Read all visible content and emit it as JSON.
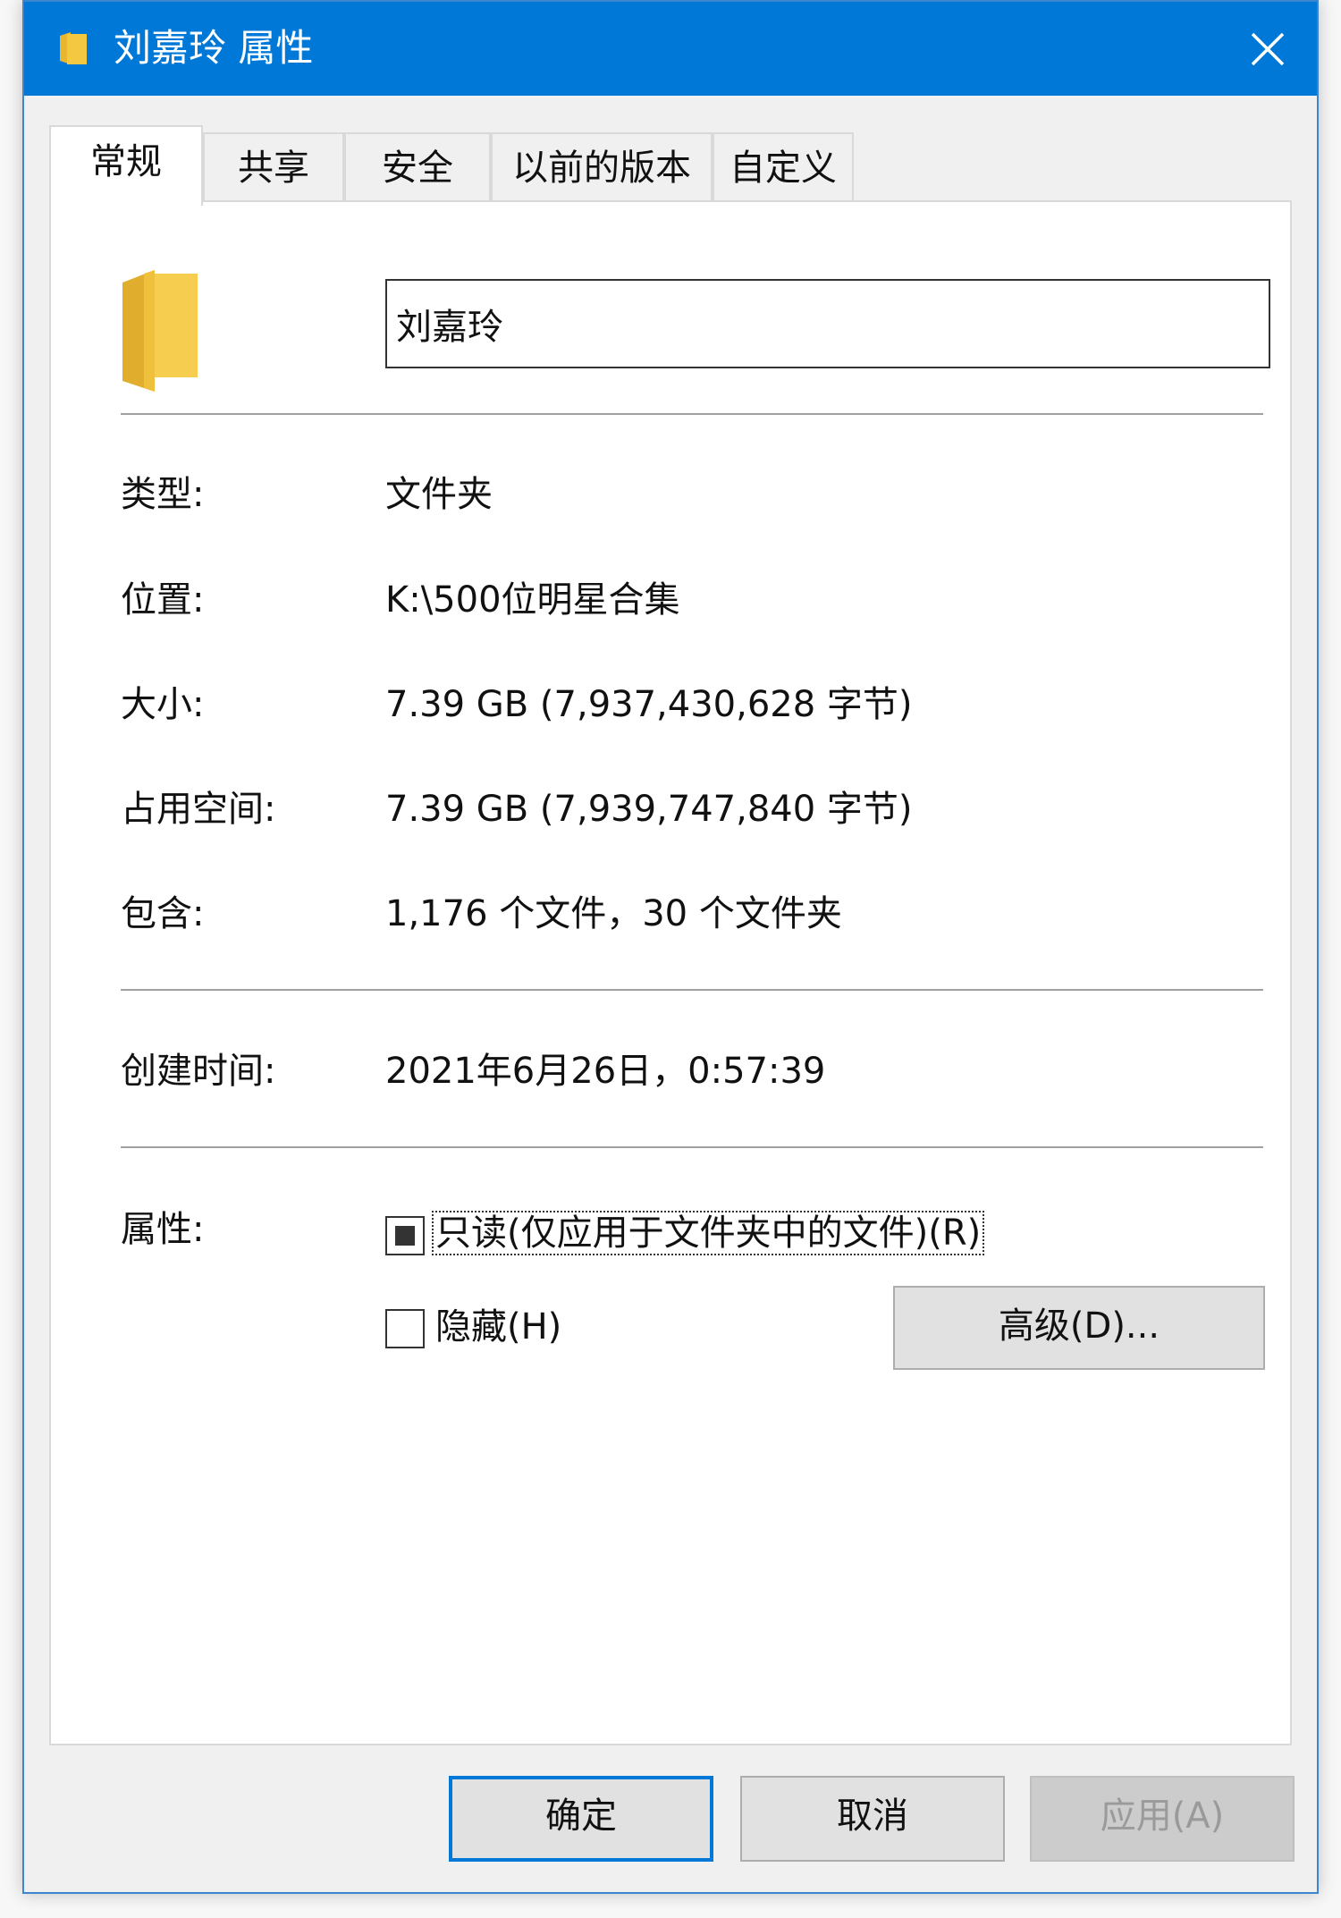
{
  "window": {
    "title": "刘嘉玲 属性",
    "title_icon": "folder-icon",
    "close_icon": "close-icon"
  },
  "tabs": [
    {
      "label": "常规",
      "active": true
    },
    {
      "label": "共享",
      "active": false
    },
    {
      "label": "安全",
      "active": false
    },
    {
      "label": "以前的版本",
      "active": false
    },
    {
      "label": "自定义",
      "active": false
    }
  ],
  "general": {
    "folder_icon": "folder-icon",
    "name_value": "刘嘉玲",
    "type_label": "类型:",
    "type_value": "文件夹",
    "location_label": "位置:",
    "location_value": "K:\\500位明星合集",
    "size_label": "大小:",
    "size_value": "7.39 GB (7,937,430,628 字节)",
    "disk_label": "占用空间:",
    "disk_value": "7.39 GB (7,939,747,840 字节)",
    "contains_label": "包含:",
    "contains_value": "1,176 个文件，30 个文件夹",
    "created_label": "创建时间:",
    "created_value": "2021年6月26日，0:57:39",
    "attributes_label": "属性:",
    "readonly_label": "只读(仅应用于文件夹中的文件)(R)",
    "readonly_state": "indeterminate",
    "hidden_label": "隐藏(H)",
    "hidden_state": "unchecked",
    "advanced_label": "高级(D)..."
  },
  "footer": {
    "ok_label": "确定",
    "cancel_label": "取消",
    "apply_label": "应用(A)",
    "apply_enabled": false
  },
  "colors": {
    "titlebar": "#0078d7",
    "folder": "#f5c842",
    "default_button_border": "#0078d7"
  }
}
